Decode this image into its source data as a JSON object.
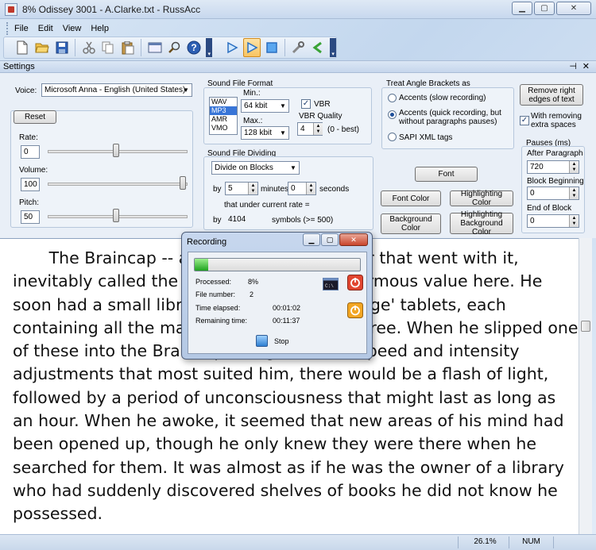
{
  "window": {
    "title": "8% Odissey 3001 - A.Clarke.txt - RussAcc"
  },
  "menu": [
    "File",
    "Edit",
    "View",
    "Help"
  ],
  "settings": {
    "header": "Settings",
    "voice_label": "Voice:",
    "voice_value": "Microsoft Anna - English (United States)",
    "reset": "Reset",
    "rate_label": "Rate:",
    "rate_value": "0",
    "volume_label": "Volume:",
    "volume_value": "100",
    "pitch_label": "Pitch:",
    "pitch_value": "50",
    "sound_format": {
      "title": "Sound File Format",
      "formats": [
        "WAV",
        "MP3",
        "AMR",
        "VMO"
      ],
      "selected": "MP3",
      "min_label": "Min.:",
      "min_value": "64 kbit",
      "max_label": "Max.:",
      "max_value": "128 kbit",
      "vbr_label": "VBR",
      "vbr_quality_label": "VBR Quality",
      "vbr_quality_value": "4",
      "vbr_quality_hint": "(0 - best)"
    },
    "dividing": {
      "title": "Sound File Dividing",
      "mode": "Divide on Blocks",
      "by": "by",
      "minutes_value": "5",
      "minutes_label": "minutes",
      "seconds_value": "0",
      "seconds_label": "seconds",
      "rate_note": "that under current rate =",
      "by2": "by",
      "symbols_value": "4104",
      "symbols_label": "symbols (>= 500)"
    },
    "angle_brackets": {
      "title": "Treat Angle Brackets as",
      "opt1": "Accents (slow recording)",
      "opt2a": "Accents (quick recording, but",
      "opt2b": "without paragraphs pauses)",
      "opt3": "SAPI XML tags"
    },
    "buttons": {
      "font": "Font",
      "font_color": "Font Color",
      "highlighting_color": "Highlighting Color",
      "background_color": "Background Color",
      "highlighting_background_color_a": "Highlighting",
      "highlighting_background_color_b": "Background Color",
      "remove_right_a": "Remove right",
      "remove_right_b": "edges of text"
    },
    "extra_spaces_a": "With removing",
    "extra_spaces_b": "extra spaces",
    "pauses": {
      "title": "Pauses (ms)",
      "after_paragraph_label": "After Paragraph",
      "after_paragraph_value": "720",
      "block_beginning_label": "Block Beginning",
      "block_beginning_value": "0",
      "end_of_block_label": "End of Block",
      "end_of_block_value": "0"
    }
  },
  "document": {
    "text": "       The Braincap -- and the Braincap Player that went with it, inevitably called the Brainman -- are of enormous value here. He soon had a small library of 'Instant Knowledge' tablets, each containing all the material for a college degree. When he slipped one of these into the Braincap and gave it the speed and intensity adjustments that most suited him, there would be a flash of light, followed by a period of unconsciousness that might last as long as an hour. When he awoke, it seemed that new areas of his mind had been opened up, though he only knew they were there when he searched for them. It was almost as if he was the owner of a library who had suddenly discovered shelves of books he did not know he possessed."
  },
  "recording": {
    "title": "Recording",
    "progress_fraction": 0.08,
    "processed_label": "Processed:",
    "processed_value": "8%",
    "file_number_label": "File number:",
    "file_number_value": "2",
    "elapsed_label": "Time elapsed:",
    "elapsed_value": "00:01:02",
    "remaining_label": "Remaining time:",
    "remaining_value": "00:11:37",
    "stop_label": "Stop"
  },
  "status": {
    "percent": "26.1%",
    "num": "NUM"
  },
  "icons": [
    "new-icon",
    "open-icon",
    "save-icon",
    "cut-icon",
    "copy-icon",
    "paste-icon",
    "window-icon",
    "find-icon",
    "help-icon",
    "play-icon",
    "play-active-icon",
    "stop-icon",
    "tools-icon",
    "back-icon",
    "cmd-icon",
    "power-red-icon",
    "power-orange-icon"
  ]
}
